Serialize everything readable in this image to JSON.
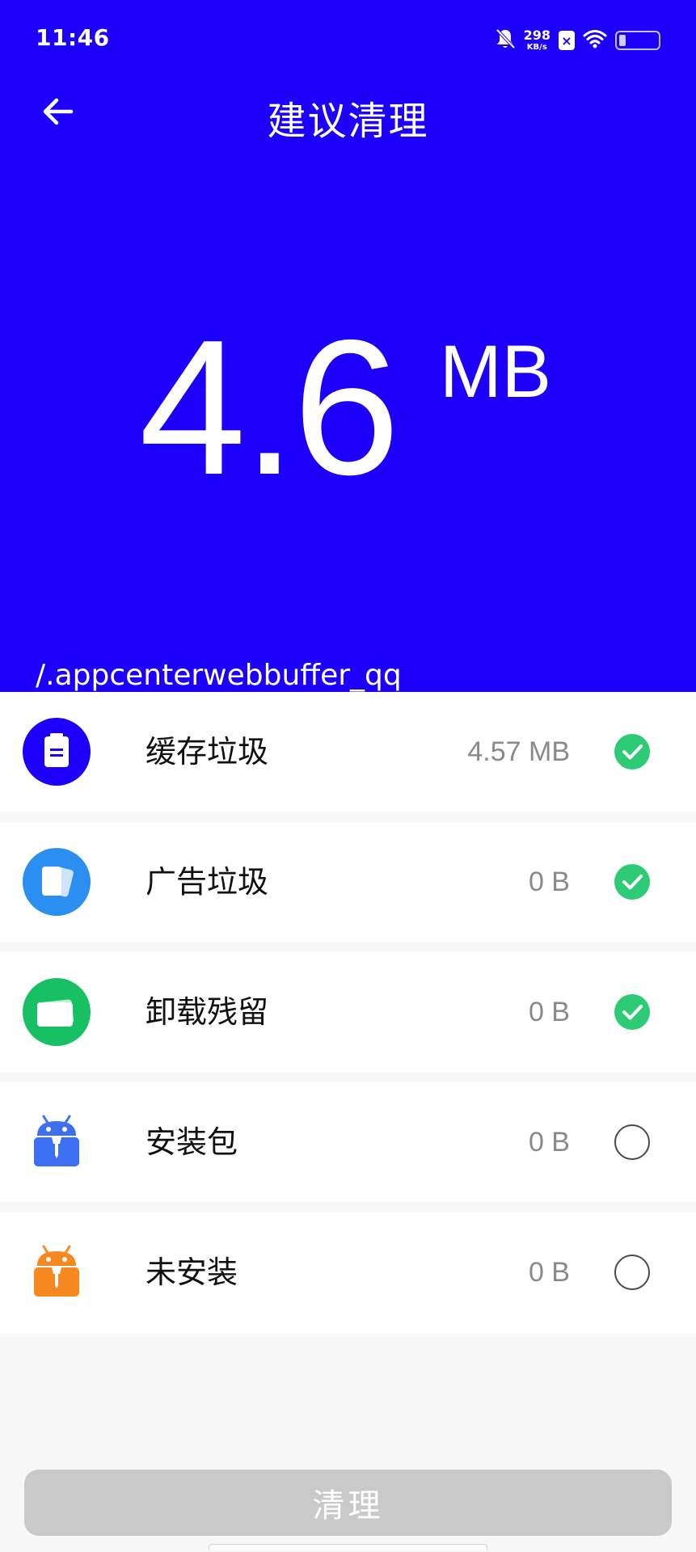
{
  "status_bar": {
    "time": "11:46",
    "net_speed_value": "298",
    "net_speed_unit": "KB/s",
    "sim_badge": "×",
    "icons": [
      "bell-muted-icon",
      "sim-icon",
      "wifi-icon",
      "battery-icon"
    ]
  },
  "header": {
    "title": "建议清理",
    "back_icon": "arrow-left-icon"
  },
  "summary": {
    "size_value": "4.6",
    "size_unit": "MB",
    "scan_path": "/.appcenterwebbuffer_qq"
  },
  "categories": [
    {
      "label": "缓存垃圾",
      "size": "4.57 MB",
      "checked": true,
      "icon": "cache-clipboard-icon",
      "icon_color": "#1c00fa"
    },
    {
      "label": "广告垃圾",
      "size": "0 B",
      "checked": true,
      "icon": "ad-cards-icon",
      "icon_color": "#2a8ff0"
    },
    {
      "label": "卸载残留",
      "size": "0 B",
      "checked": true,
      "icon": "uninstall-residue-icon",
      "icon_color": "#17c062"
    },
    {
      "label": "安装包",
      "size": "0 B",
      "checked": false,
      "icon": "android-package-icon",
      "icon_color": "#3d6ff2"
    },
    {
      "label": "未安装",
      "size": "0 B",
      "checked": false,
      "icon": "android-package-icon",
      "icon_color": "#f5891f"
    }
  ],
  "footer": {
    "clean_button_label": "清理"
  },
  "colors": {
    "hero_background": "#1c00fa",
    "check_on": "#2ecb76",
    "button_disabled": "#c9c9c9"
  }
}
